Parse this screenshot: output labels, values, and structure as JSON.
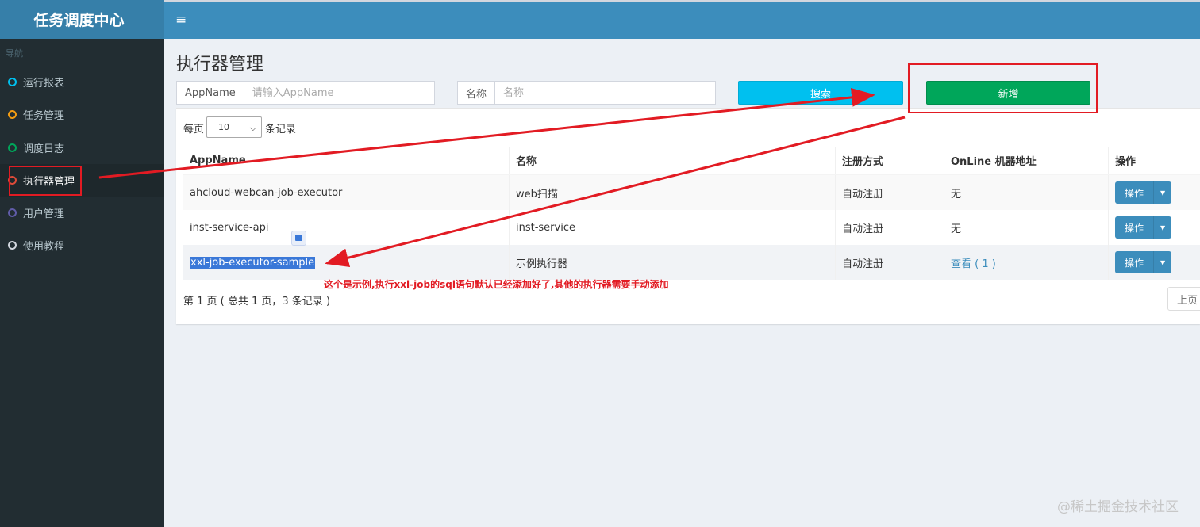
{
  "app": {
    "title": "任务调度中心"
  },
  "header": {
    "menu_icon": "≡"
  },
  "sidebar": {
    "header": "导航",
    "items": [
      {
        "label": "运行报表",
        "color": "#00c0ef"
      },
      {
        "label": "任务管理",
        "color": "#f39c12"
      },
      {
        "label": "调度日志",
        "color": "#00a65a"
      },
      {
        "label": "执行器管理",
        "color": "#dd4b39",
        "active": true
      },
      {
        "label": "用户管理",
        "color": "#605ca8"
      },
      {
        "label": "使用教程",
        "color": "#d2d6de"
      }
    ]
  },
  "main": {
    "title": "执行器管理",
    "filters": {
      "appname_label": "AppName",
      "appname_placeholder": "请输入AppName",
      "name_label": "名称",
      "name_placeholder": "名称"
    },
    "search_button": "搜索",
    "add_button": "新增",
    "length": {
      "prefix": "每页",
      "value": "10",
      "suffix": "条记录"
    },
    "table": {
      "columns": [
        "AppName",
        "名称",
        "注册方式",
        "OnLine 机器地址",
        "操作"
      ],
      "rows": [
        {
          "appname": "ahcloud-webcan-job-executor",
          "name": "web扫描",
          "reg": "自动注册",
          "online": "无",
          "op": "操作"
        },
        {
          "appname": "inst-service-api",
          "name": "inst-service",
          "reg": "自动注册",
          "online": "无",
          "op": "操作"
        },
        {
          "appname": "xxl-job-executor-sample",
          "name": "示例执行器",
          "reg": "自动注册",
          "online": "查看 ( 1 )",
          "op": "操作"
        }
      ]
    },
    "info": "第 1 页 ( 总共 1 页，3 条记录 )",
    "prev": "上页"
  },
  "annotation": {
    "text": "这个是示例,执行xxl-job的sql语句默认已经添加好了,其他的执行器需要手动添加",
    "color": "#e21b23"
  },
  "watermark": "@稀土掘金技术社区"
}
